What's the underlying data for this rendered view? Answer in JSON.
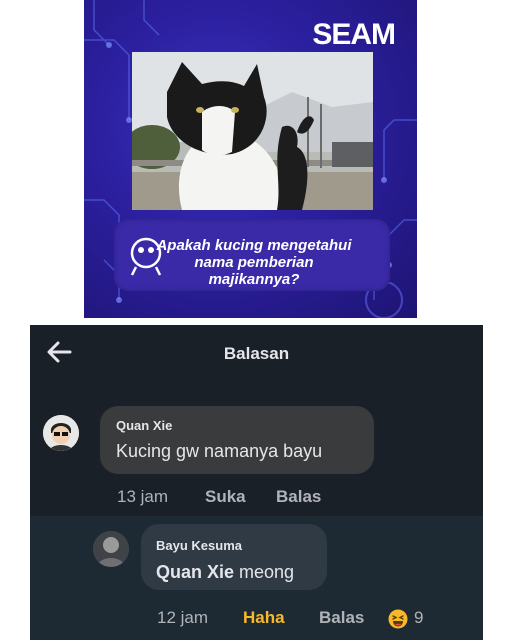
{
  "post": {
    "brand": "SEAM",
    "caption_line1": "Apakah kucing mengetahui",
    "caption_line2": "nama pemberian",
    "caption_line3": "majikannya?"
  },
  "panel": {
    "title": "Balasan"
  },
  "comment": {
    "author": "Quan Xie",
    "text": "Kucing gw namanya bayu",
    "time": "13 jam",
    "like_label": "Suka",
    "reply_label": "Balas"
  },
  "reply": {
    "author": "Bayu Kesuma",
    "mention": "Quan Xie",
    "text": " meong",
    "time": "12 jam",
    "reaction_label": "Haha",
    "reply_label": "Balas",
    "reaction_count": "9",
    "reaction_icon": "haha-emoji-icon"
  },
  "colors": {
    "panel_bg": "#1a2027",
    "bubble_bg": "#3a3b3c",
    "haha_color": "#f7b928",
    "post_bg": "#2b1f9e"
  }
}
